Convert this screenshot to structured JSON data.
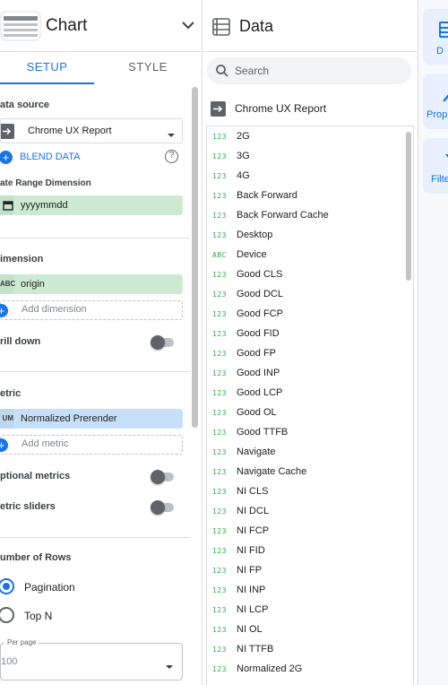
{
  "chart_panel": {
    "title": "Chart",
    "tabs": {
      "setup": "SETUP",
      "style": "STYLE"
    },
    "data_source": {
      "label": "ata source",
      "value": "Chrome UX Report",
      "blend": "BLEND DATA"
    },
    "date_range": {
      "label": "ate Range Dimension",
      "value": "yyyymmdd"
    },
    "dimension": {
      "label": "imension",
      "tag": "ABC",
      "value": "origin",
      "add_placeholder": "Add dimension"
    },
    "drill_down": {
      "label": "rill down"
    },
    "metric": {
      "label": "etric",
      "tag": "UM",
      "value": "Normalized Prerender",
      "add_placeholder": "Add metric"
    },
    "optional_metrics": {
      "label": "ptional metrics"
    },
    "metric_sliders": {
      "label": "etric sliders"
    },
    "rows": {
      "label": "umber of Rows",
      "options": [
        "Pagination",
        "Top N"
      ],
      "selected": "Pagination",
      "per_page_label": "Per page",
      "per_page_value": "100"
    }
  },
  "data_panel": {
    "title": "Data",
    "search_placeholder": "Search",
    "source_name": "Chrome UX Report",
    "fields": [
      {
        "type": "123",
        "name": "2G"
      },
      {
        "type": "123",
        "name": "3G"
      },
      {
        "type": "123",
        "name": "4G"
      },
      {
        "type": "123",
        "name": "Back Forward"
      },
      {
        "type": "123",
        "name": "Back Forward Cache"
      },
      {
        "type": "123",
        "name": "Desktop"
      },
      {
        "type": "ABC",
        "name": "Device"
      },
      {
        "type": "123",
        "name": "Good CLS"
      },
      {
        "type": "123",
        "name": "Good DCL"
      },
      {
        "type": "123",
        "name": "Good FCP"
      },
      {
        "type": "123",
        "name": "Good FID"
      },
      {
        "type": "123",
        "name": "Good FP"
      },
      {
        "type": "123",
        "name": "Good INP"
      },
      {
        "type": "123",
        "name": "Good LCP"
      },
      {
        "type": "123",
        "name": "Good OL"
      },
      {
        "type": "123",
        "name": "Good TTFB"
      },
      {
        "type": "123",
        "name": "Navigate"
      },
      {
        "type": "123",
        "name": "Navigate Cache"
      },
      {
        "type": "123",
        "name": "NI CLS"
      },
      {
        "type": "123",
        "name": "NI DCL"
      },
      {
        "type": "123",
        "name": "NI FCP"
      },
      {
        "type": "123",
        "name": "NI FID"
      },
      {
        "type": "123",
        "name": "NI FP"
      },
      {
        "type": "123",
        "name": "NI INP"
      },
      {
        "type": "123",
        "name": "NI LCP"
      },
      {
        "type": "123",
        "name": "NI OL"
      },
      {
        "type": "123",
        "name": "NI TTFB"
      },
      {
        "type": "123",
        "name": "Normalized 2G"
      }
    ]
  },
  "right_rail": {
    "items": [
      {
        "label": "D",
        "icon": "data-icon"
      },
      {
        "label": "Prop",
        "icon": "properties-icon"
      },
      {
        "label": "Filte",
        "icon": "filter-icon"
      }
    ]
  },
  "colors": {
    "accent": "#1a73e8",
    "dimension_chip": "#cdebd3",
    "metric_chip": "#c6e1f7",
    "field_type": "#34a853"
  }
}
